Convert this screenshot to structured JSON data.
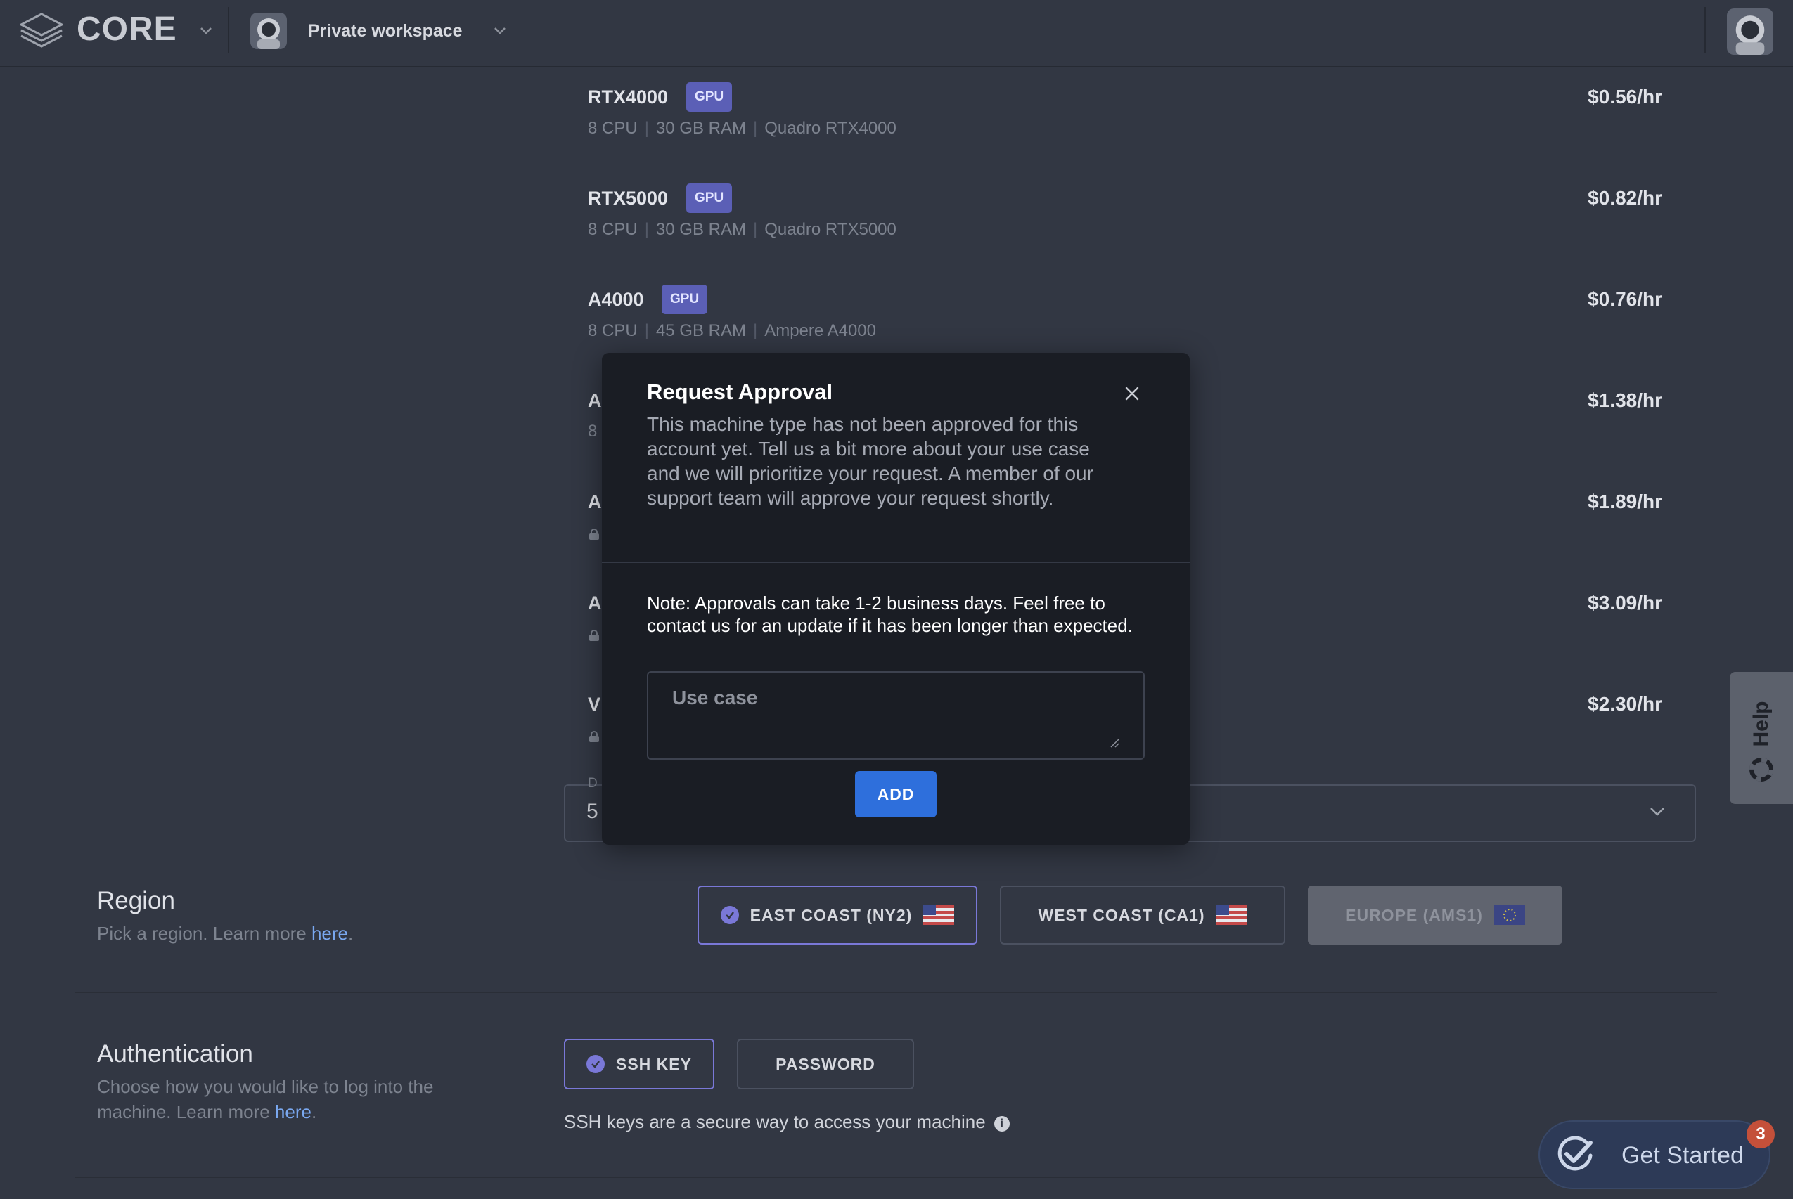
{
  "header": {
    "brand": "CORE",
    "workspace_label": "Private workspace"
  },
  "machines": [
    {
      "name": "RTX4000",
      "badge": "GPU",
      "cpu": "8 CPU",
      "ram": "30 GB RAM",
      "gpu_model": "Quadro RTX4000",
      "price": "$0.56/hr"
    },
    {
      "name": "RTX5000",
      "badge": "GPU",
      "cpu": "8 CPU",
      "ram": "30 GB RAM",
      "gpu_model": "Quadro RTX5000",
      "price": "$0.82/hr"
    },
    {
      "name": "A4000",
      "badge": "GPU",
      "cpu": "8 CPU",
      "ram": "45 GB RAM",
      "gpu_model": "Ampere A4000",
      "price": "$0.76/hr"
    }
  ],
  "obscured_machines": [
    {
      "name_fragment": "A",
      "spec_fragment": "8",
      "price": "$1.38/hr"
    },
    {
      "name_fragment": "A",
      "price": "$1.89/hr"
    },
    {
      "name_fragment": "A",
      "price": "$3.09/hr"
    },
    {
      "name_fragment": "V",
      "price": "$2.30/hr"
    }
  ],
  "disk": {
    "label_fragment": "D",
    "value_fragment": "5"
  },
  "region": {
    "title": "Region",
    "subtitle": "Pick a region. Learn more ",
    "link": "here",
    "options": [
      {
        "label": "EAST COAST (NY2)",
        "state": "selected",
        "flag": "us-flag-icon"
      },
      {
        "label": "WEST COAST (CA1)",
        "state": "default",
        "flag": "us-flag-icon"
      },
      {
        "label": "EUROPE (AMS1)",
        "state": "disabled",
        "flag": "eu-flag-icon"
      }
    ]
  },
  "authentication": {
    "title": "Authentication",
    "subtitle_line1": "Choose how you would like to log into the",
    "subtitle_line2": "machine. Learn more ",
    "link": "here",
    "options": [
      {
        "label": "SSH KEY",
        "state": "selected"
      },
      {
        "label": "PASSWORD",
        "state": "default"
      }
    ],
    "note": "SSH keys are a secure way to access your machine"
  },
  "help": {
    "label": "Help"
  },
  "get_started": {
    "label": "Get Started",
    "badge_count": "3"
  },
  "modal": {
    "title": "Request Approval",
    "description": "This machine type has not been approved for this account yet. Tell us a bit more about your use case and we will prioritize your request. A member of our support team will approve your request shortly.",
    "note": "Note: Approvals can take 1-2 business days. Feel free to contact us for an update if it has been longer than expected.",
    "input_placeholder": "Use case",
    "input_value": "",
    "submit_label": "ADD"
  },
  "colors": {
    "background": "#323743",
    "modal_background": "#1a1d24",
    "accent_purple": "#7a78d8",
    "gpu_badge": "#5b5fb6",
    "primary_button": "#2e6fdc",
    "link": "#7aa8f0",
    "badge_red": "#c4503a"
  }
}
